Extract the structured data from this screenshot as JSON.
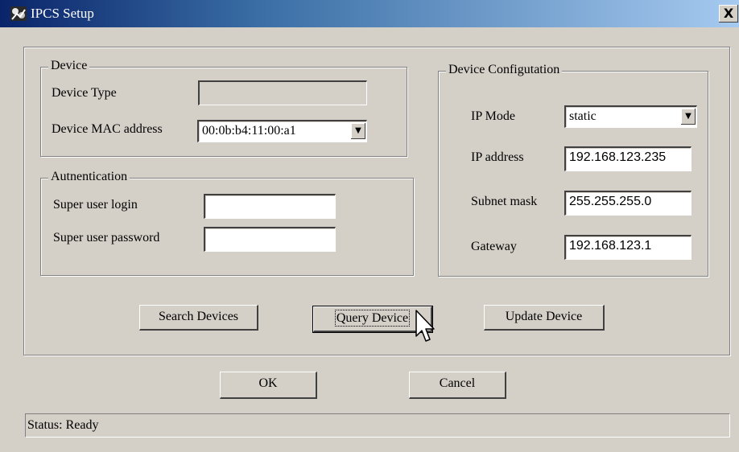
{
  "window": {
    "title": "IPCS Setup",
    "close_glyph": "X"
  },
  "device": {
    "group_label": "Device",
    "type_label": "Device Type",
    "type_value": "",
    "mac_label": "Device MAC address",
    "mac_value": "00:0b:b4:11:00:a1"
  },
  "auth": {
    "group_label": "Autnentication",
    "login_label": "Super user login",
    "login_value": "",
    "password_label": "Super user password",
    "password_value": ""
  },
  "config": {
    "group_label": "Device Configutation",
    "ip_mode_label": "IP Mode",
    "ip_mode_value": "static",
    "ip_address_label": "IP address",
    "ip_address_value": "192.168.123.235",
    "subnet_label": "Subnet mask",
    "subnet_value": "255.255.255.0",
    "gateway_label": "Gateway",
    "gateway_value": "192.168.123.1"
  },
  "actions": {
    "search_label": "Search Devices",
    "query_label": "Query Device",
    "update_label": "Update Device"
  },
  "dialog": {
    "ok_label": "OK",
    "cancel_label": "Cancel"
  },
  "status": {
    "text": "Status: Ready"
  },
  "icons": {
    "app": "ipcs-app-icon",
    "close": "close-icon",
    "dropdown": "chevron-down-icon",
    "cursor": "mouse-pointer-icon"
  },
  "colors": {
    "face": "#d4d0c8",
    "title_start": "#0a246a",
    "title_end": "#a6caf0"
  }
}
